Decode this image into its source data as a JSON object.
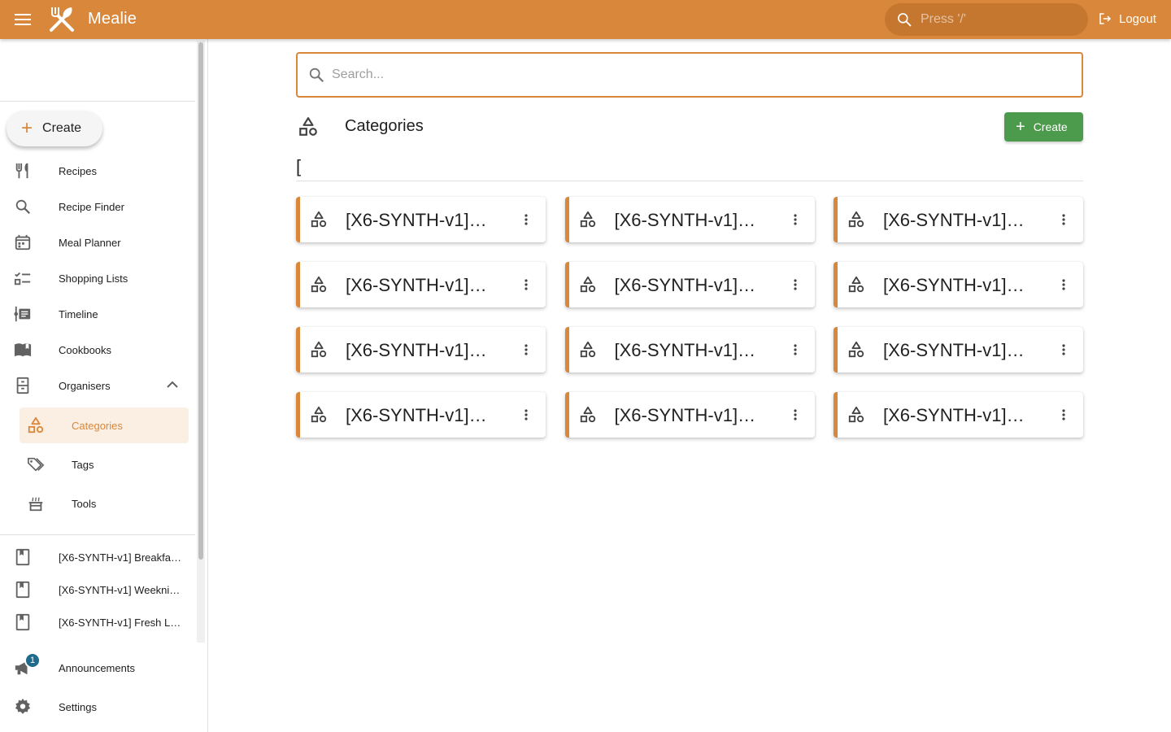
{
  "app": {
    "title": "Mealie"
  },
  "topbar": {
    "search_placeholder": "Press '/'",
    "logout_label": "Logout"
  },
  "sidebar": {
    "create_label": "Create",
    "items": [
      {
        "label": "Recipes",
        "icon": "fork-knife-icon"
      },
      {
        "label": "Recipe Finder",
        "icon": "search-icon"
      },
      {
        "label": "Meal Planner",
        "icon": "calendar-icon"
      },
      {
        "label": "Shopping Lists",
        "icon": "checklist-icon"
      },
      {
        "label": "Timeline",
        "icon": "timeline-icon"
      },
      {
        "label": "Cookbooks",
        "icon": "book-open-icon"
      },
      {
        "label": "Organisers",
        "icon": "file-cabinet-icon"
      }
    ],
    "organisers": [
      {
        "label": "Categories",
        "icon": "shapes-icon"
      },
      {
        "label": "Tags",
        "icon": "tags-icon"
      },
      {
        "label": "Tools",
        "icon": "pot-icon"
      }
    ],
    "cookbooks": [
      {
        "label": "[X6-SYNTH-v1] Breakfa…"
      },
      {
        "label": "[X6-SYNTH-v1] Weekni…"
      },
      {
        "label": "[X6-SYNTH-v1] Fresh L…"
      }
    ],
    "announcements_label": "Announcements",
    "announcements_badge": "1",
    "settings_label": "Settings"
  },
  "main": {
    "search_placeholder": "Search...",
    "page_title": "Categories",
    "create_label": "Create",
    "filter_text": "[",
    "cards": [
      "[X6-SYNTH-v1]…",
      "[X6-SYNTH-v1]…",
      "[X6-SYNTH-v1]…",
      "[X6-SYNTH-v1]…",
      "[X6-SYNTH-v1]…",
      "[X6-SYNTH-v1]…",
      "[X6-SYNTH-v1]…",
      "[X6-SYNTH-v1]…",
      "[X6-SYNTH-v1]…",
      "[X6-SYNTH-v1]…",
      "[X6-SYNTH-v1]…",
      "[X6-SYNTH-v1]…"
    ]
  },
  "colors": {
    "primary": "#d9883b",
    "success": "#4c9a4c",
    "active_bg": "#fbeee2",
    "badge": "#1e6b8c"
  }
}
